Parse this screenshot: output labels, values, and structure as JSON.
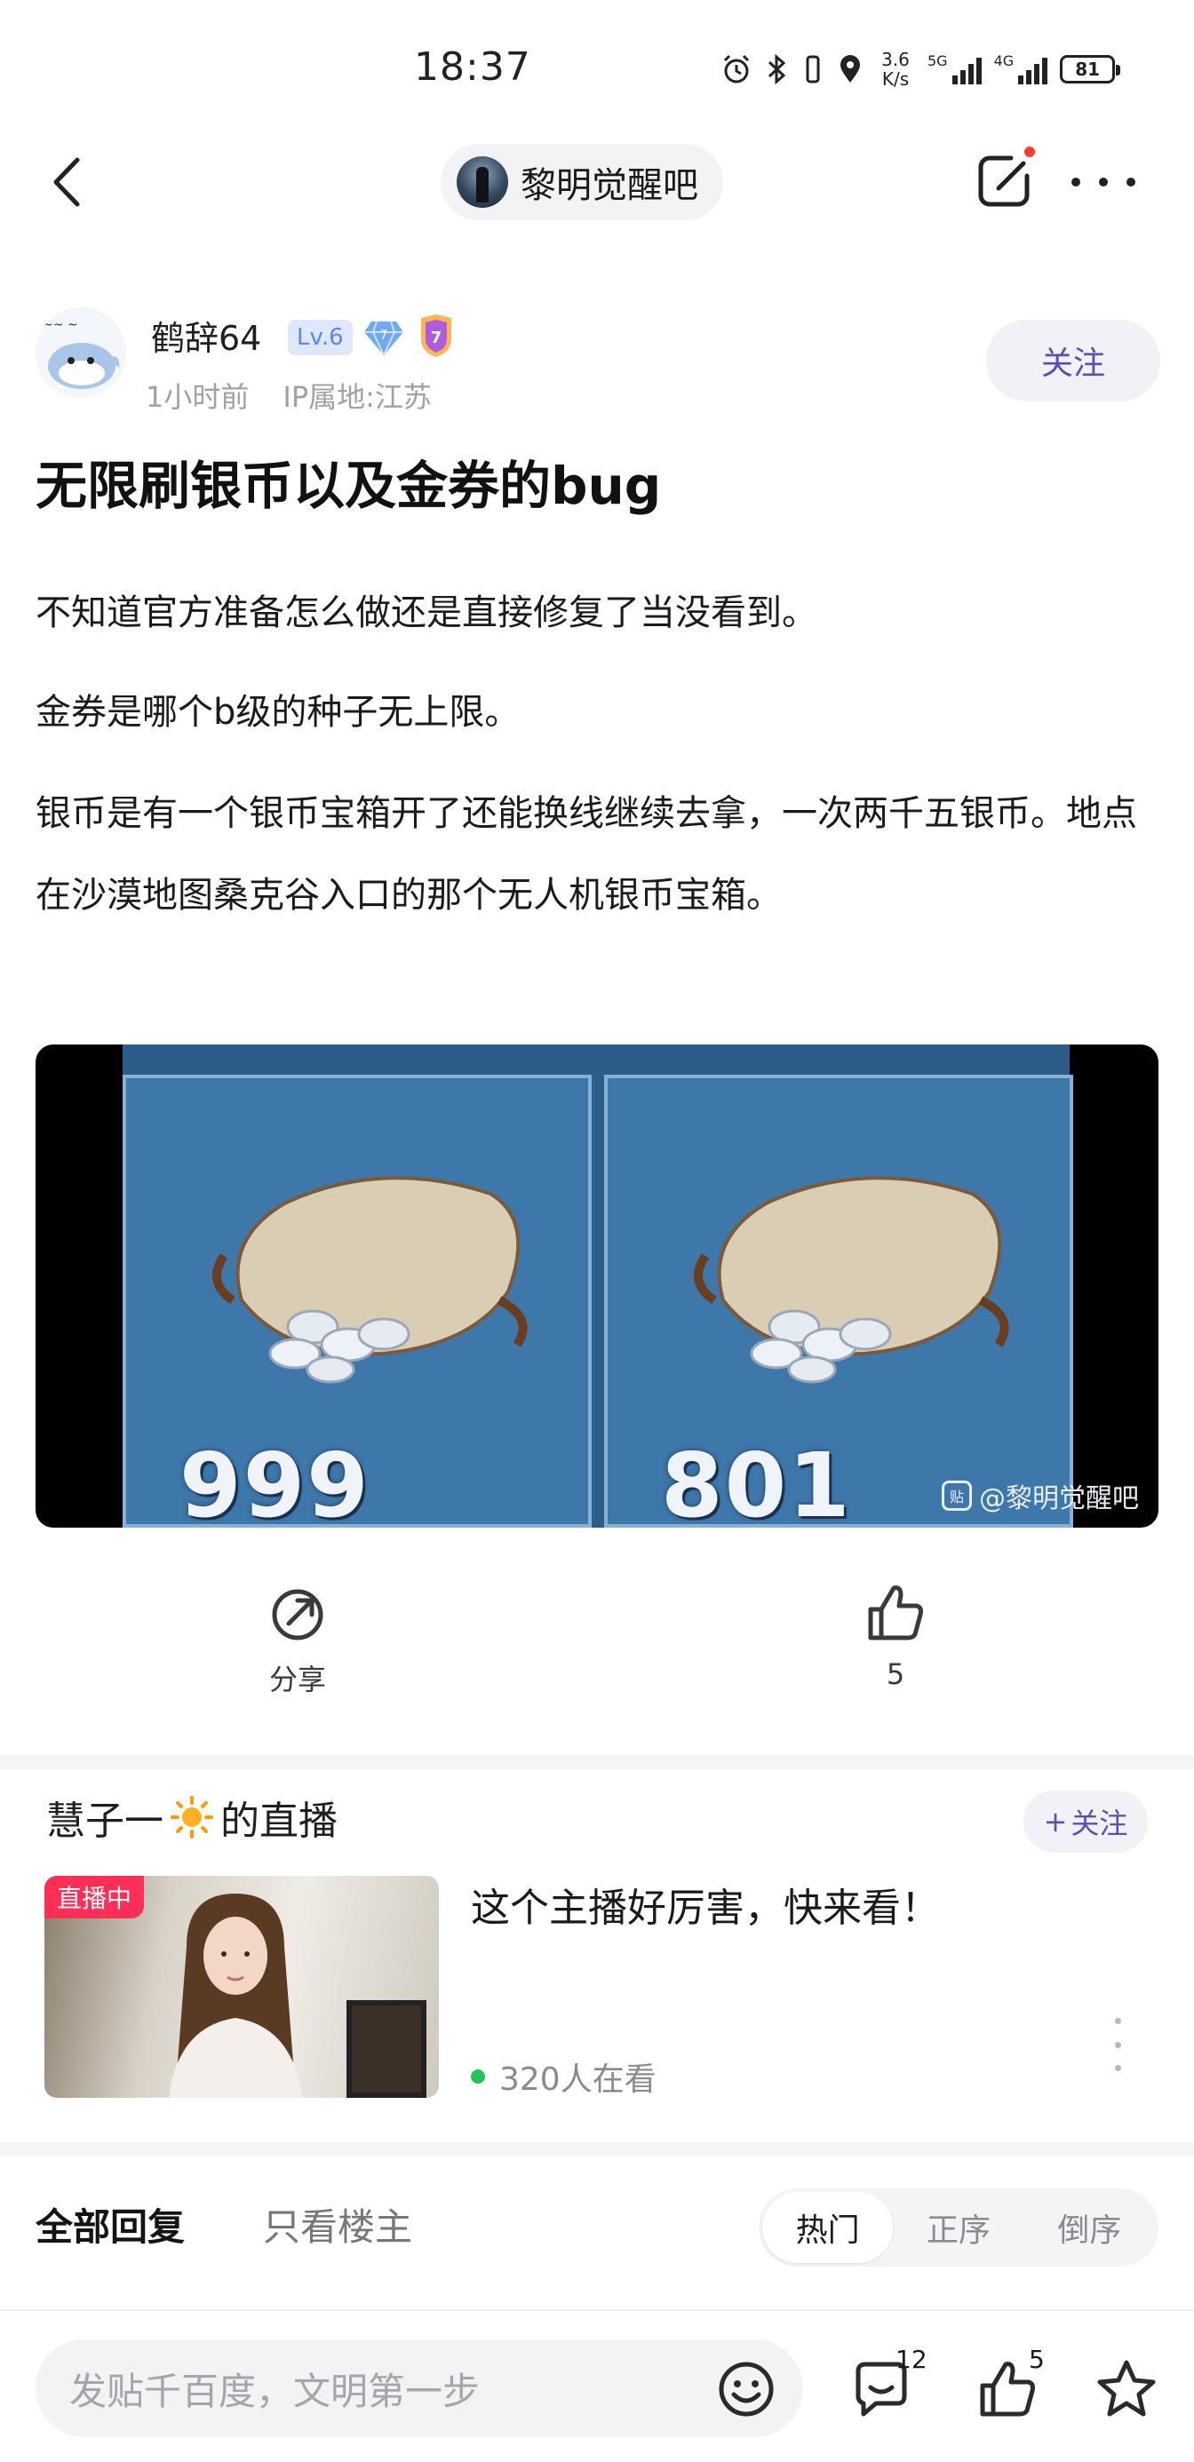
{
  "status_bar": {
    "time": "18:37",
    "net_speed_value": "3.6",
    "net_speed_unit": "K/s",
    "sim1_label": "5G",
    "sim2_label": "4G",
    "battery": "81"
  },
  "nav": {
    "forum_name": "黎明觉醒吧"
  },
  "author": {
    "name": "鹤辞64",
    "level": "Lv.6",
    "gem_level": "7",
    "medal_level": "7",
    "time_ago": "1小时前",
    "ip_location": "IP属地:江苏",
    "follow_label": "关注"
  },
  "post": {
    "title": "无限刷银币以及金券的bug",
    "paragraphs": [
      "不知道官方准备怎么做还是直接修复了当没看到。",
      "金券是哪个b级的种子无上限。",
      "银币是有一个银币宝箱开了还能换线继续去拿，一次两千五银币。地点在沙漠地图桑克谷入口的那个无人机银币宝箱。"
    ],
    "image": {
      "qty_left": "999",
      "qty_right": "801",
      "watermark": "@黎明觉醒吧",
      "watermark_logo": "贴"
    }
  },
  "actions": {
    "share_label": "分享",
    "like_count": "5"
  },
  "live": {
    "title_prefix": "慧子一",
    "title_suffix": "的直播",
    "follow_plus": "+",
    "follow_label": "关注",
    "badge": "直播中",
    "description": "这个主播好厉害，快来看！",
    "viewers": "320人在看"
  },
  "reply_tabs": {
    "all": "全部回复",
    "owner_only": "只看楼主",
    "sort": [
      "热门",
      "正序",
      "倒序"
    ],
    "active_sort": "热门"
  },
  "bottom_bar": {
    "input_placeholder": "发贴千百度，文明第一步",
    "comment_count": "12",
    "like_count": "5"
  },
  "colors": {
    "accent": "#5a4fb4",
    "live_badge": "#ff2e56",
    "online_dot": "#23c45a"
  }
}
